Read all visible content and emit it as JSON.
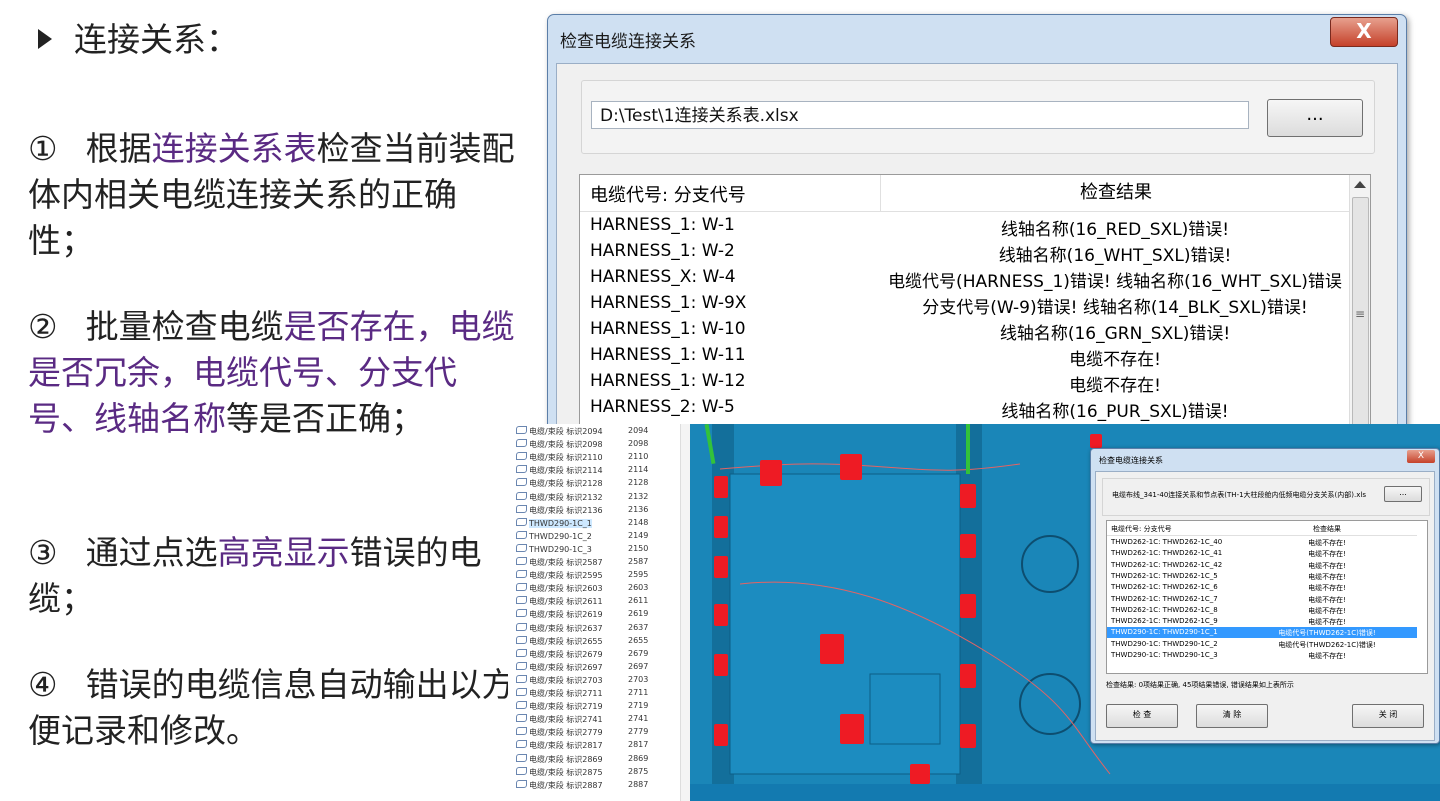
{
  "slide": {
    "title": "连接关系：",
    "points": [
      {
        "num": "①",
        "parts": [
          {
            "t": "根据",
            "hl": false
          },
          {
            "t": "连接关系表",
            "hl": true
          },
          {
            "t": "检查当前装配体内相关电缆连接关系的正确性；",
            "hl": false
          }
        ]
      },
      {
        "num": "②",
        "parts": [
          {
            "t": "批量检查电缆",
            "hl": false
          },
          {
            "t": "是否存在，电缆是否冗余，电缆代号、分支代号、线轴名称",
            "hl": true
          },
          {
            "t": "等是否正确；",
            "hl": false
          }
        ]
      },
      {
        "num": "③",
        "parts": [
          {
            "t": "通过点选",
            "hl": false
          },
          {
            "t": "高亮显示",
            "hl": true
          },
          {
            "t": "错误的电缆；",
            "hl": false
          }
        ]
      },
      {
        "num": "④",
        "parts": [
          {
            "t": "错误的电缆信息自动输出以方便记录和修改。",
            "hl": false
          }
        ]
      }
    ]
  },
  "dialog": {
    "title": "检查电缆连接关系",
    "close_label": "X",
    "file_path": "D:\\Test\\1连接关系表.xlsx",
    "browse_label": "...",
    "columns": [
      "电缆代号: 分支代号",
      "检查结果"
    ],
    "rows": [
      [
        "HARNESS_1: W-1",
        "线轴名称(16_RED_SXL)错误!"
      ],
      [
        "HARNESS_1: W-2",
        "线轴名称(16_WHT_SXL)错误!"
      ],
      [
        "HARNESS_X: W-4",
        "电缆代号(HARNESS_1)错误! 线轴名称(16_WHT_SXL)错误"
      ],
      [
        "HARNESS_1: W-9X",
        "分支代号(W-9)错误! 线轴名称(14_BLK_SXL)错误!"
      ],
      [
        "HARNESS_1: W-10",
        "线轴名称(16_GRN_SXL)错误!"
      ],
      [
        "HARNESS_1: W-11",
        "电缆不存在!"
      ],
      [
        "HARNESS_1: W-12",
        "电缆不存在!"
      ],
      [
        "HARNESS_2: W-5",
        "线轴名称(16_PUR_SXL)错误!"
      ]
    ]
  },
  "tree": {
    "items": [
      [
        "电缆/束段 标识2094",
        "2094"
      ],
      [
        "电缆/束段 标识2098",
        "2098"
      ],
      [
        "电缆/束段 标识2110",
        "2110"
      ],
      [
        "电缆/束段 标识2114",
        "2114"
      ],
      [
        "电缆/束段 标识2128",
        "2128"
      ],
      [
        "电缆/束段 标识2132",
        "2132"
      ],
      [
        "电缆/束段 标识2136",
        "2136"
      ],
      [
        "THWD290-1C_1",
        "2148"
      ],
      [
        "THWD290-1C_2",
        "2149"
      ],
      [
        "THWD290-1C_3",
        "2150"
      ],
      [
        "电缆/束段 标识2587",
        "2587"
      ],
      [
        "电缆/束段 标识2595",
        "2595"
      ],
      [
        "电缆/束段 标识2603",
        "2603"
      ],
      [
        "电缆/束段 标识2611",
        "2611"
      ],
      [
        "电缆/束段 标识2619",
        "2619"
      ],
      [
        "电缆/束段 标识2637",
        "2637"
      ],
      [
        "电缆/束段 标识2655",
        "2655"
      ],
      [
        "电缆/束段 标识2679",
        "2679"
      ],
      [
        "电缆/束段 标识2697",
        "2697"
      ],
      [
        "电缆/束段 标识2703",
        "2703"
      ],
      [
        "电缆/束段 标识2711",
        "2711"
      ],
      [
        "电缆/束段 标识2719",
        "2719"
      ],
      [
        "电缆/束段 标识2741",
        "2741"
      ],
      [
        "电缆/束段 标识2779",
        "2779"
      ],
      [
        "电缆/束段 标识2817",
        "2817"
      ],
      [
        "电缆/束段 标识2869",
        "2869"
      ],
      [
        "电缆/束段 标识2875",
        "2875"
      ],
      [
        "电缆/束段 标识2887",
        "2887"
      ]
    ],
    "selected_index": 7
  },
  "small_dialog": {
    "title": "检查电缆连接关系",
    "close_label": "X",
    "file_path": "电缆布线_341-40连接关系和节点表(TH-1大柱段舱内低频电缆分支关系(内部).xls",
    "browse_label": "...",
    "columns": [
      "电缆代号: 分支代号",
      "检查结果"
    ],
    "rows": [
      [
        "THWD262-1C: THWD262-1C_40",
        "电缆不存在!"
      ],
      [
        "THWD262-1C: THWD262-1C_41",
        "电缆不存在!"
      ],
      [
        "THWD262-1C: THWD262-1C_42",
        "电缆不存在!"
      ],
      [
        "THWD262-1C: THWD262-1C_5",
        "电缆不存在!"
      ],
      [
        "THWD262-1C: THWD262-1C_6",
        "电缆不存在!"
      ],
      [
        "THWD262-1C: THWD262-1C_7",
        "电缆不存在!"
      ],
      [
        "THWD262-1C: THWD262-1C_8",
        "电缆不存在!"
      ],
      [
        "THWD262-1C: THWD262-1C_9",
        "电缆不存在!"
      ],
      [
        "THWD290-1C: THWD290-1C_1",
        "电缆代号(THWD262-1C)错误!"
      ],
      [
        "THWD290-1C: THWD290-1C_2",
        "电缆代号(THWD262-1C)错误!"
      ],
      [
        "THWD290-1C: THWD290-1C_3",
        "电缆不存在!"
      ]
    ],
    "selected_index": 8,
    "status": "检查结果: 0项结果正确, 45项结果错误, 错误结果如上表所示",
    "buttons": {
      "check": "检 查",
      "clear": "清 除",
      "close": "关 闭"
    }
  },
  "colors": {
    "highlight_text": "#5a2a83",
    "model_blue": "#1a86b8",
    "cable_red": "#ee1b24",
    "selection": "#3399ff"
  }
}
